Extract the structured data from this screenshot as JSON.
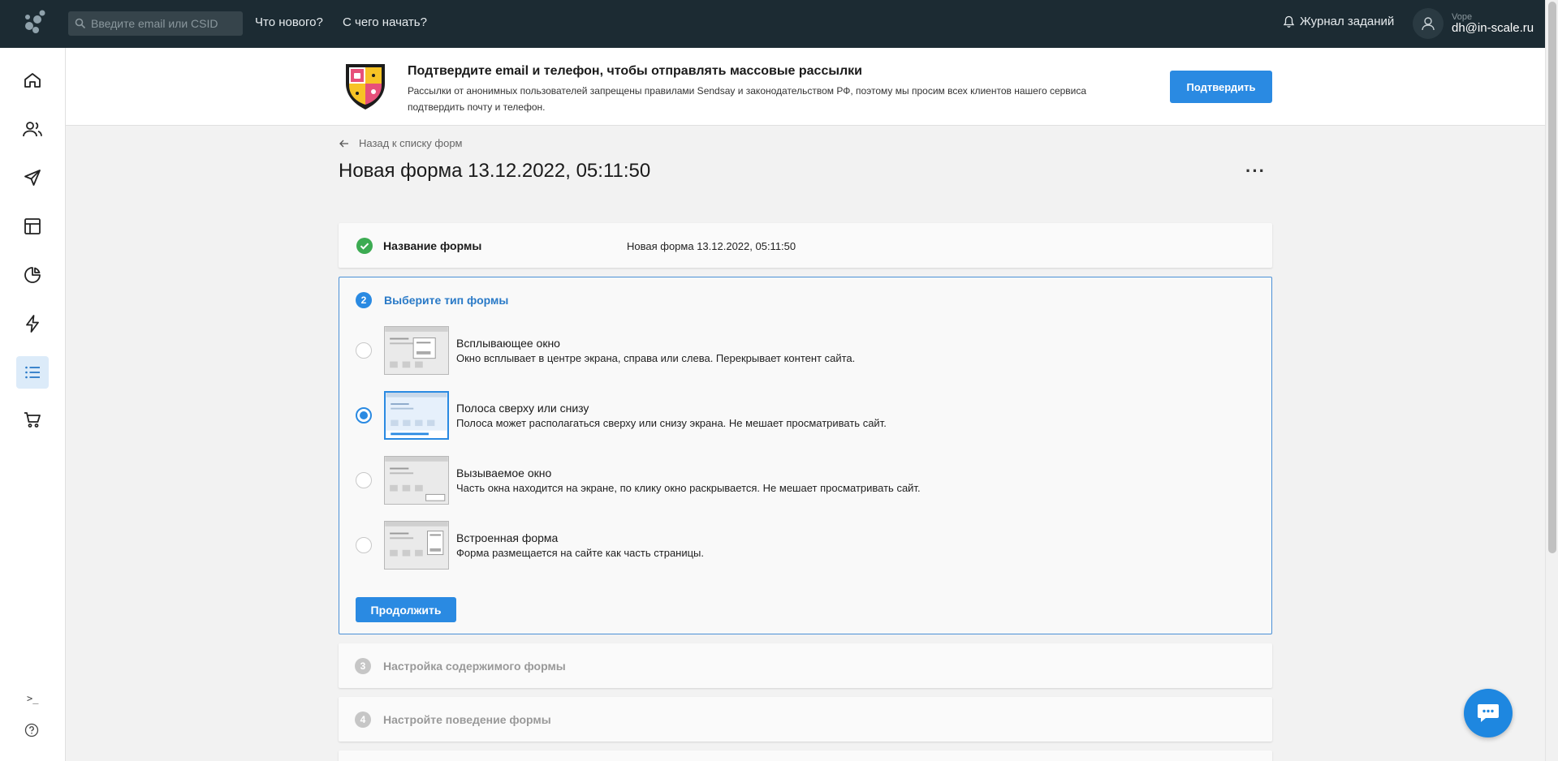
{
  "topbar": {
    "search_placeholder": "Введите email или CSID",
    "whats_new": "Что нового?",
    "getting_started": "С чего начать?",
    "jobs_log": "Журнал заданий",
    "user_name": "Vope",
    "user_email": "dh@in-scale.ru"
  },
  "sidebar": {
    "items": [
      {
        "icon": "home-icon"
      },
      {
        "icon": "users-icon"
      },
      {
        "icon": "send-icon"
      },
      {
        "icon": "template-icon"
      },
      {
        "icon": "pie-chart-icon"
      },
      {
        "icon": "lightning-icon"
      },
      {
        "icon": "list-icon",
        "active": true
      },
      {
        "icon": "cart-icon"
      }
    ],
    "console_label": ">_",
    "help_icon": "help-icon"
  },
  "banner": {
    "title": "Подтвердите email и телефон, чтобы отправлять массовые рассылки",
    "text": "Рассылки от анонимных пользователей запрещены правилами Sendsay и законодательством РФ, поэтому мы просим всех клиентов нашего сервиса подтвердить почту и телефон.",
    "button": "Подтвердить"
  },
  "page": {
    "back_link": "Назад к списку форм",
    "title": "Новая форма 13.12.2022, 05:11:50",
    "more": "···"
  },
  "steps": {
    "step1": {
      "label": "Название формы",
      "value": "Новая форма 13.12.2022, 05:11:50"
    },
    "step2": {
      "number": "2",
      "label": "Выберите тип формы",
      "options": [
        {
          "title": "Всплывающее окно",
          "desc": "Окно всплывает в центре экрана, справа или слева. Перекрывает контент сайта.",
          "selected": false
        },
        {
          "title": "Полоса сверху или снизу",
          "desc": "Полоса может располагаться сверху или снизу экрана. Не мешает просматривать сайт.",
          "selected": true
        },
        {
          "title": "Вызываемое окно",
          "desc": "Часть окна находится на экране, по клику окно раскрывается. Не мешает просматривать сайт.",
          "selected": false
        },
        {
          "title": "Встроенная форма",
          "desc": "Форма размещается на сайте как часть страницы.",
          "selected": false
        }
      ],
      "continue": "Продолжить"
    },
    "step3": {
      "number": "3",
      "label": "Настройка содержимого формы"
    },
    "step4": {
      "number": "4",
      "label": "Настройте поведение формы"
    }
  },
  "colors": {
    "accent": "#2a8ae2",
    "topbar": "#1c2b33",
    "success": "#3cab52"
  }
}
